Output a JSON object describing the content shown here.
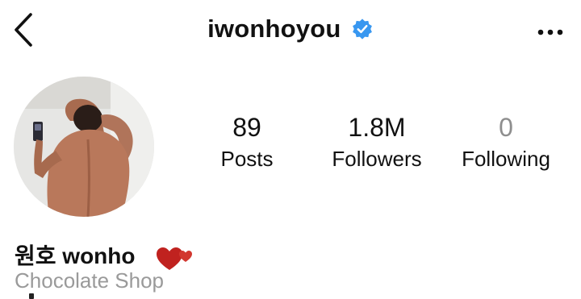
{
  "header": {
    "username": "iwonhoyou",
    "verified": true,
    "back_icon": "chevron-left-icon",
    "more_icon": "ellipsis-icon",
    "verified_color": "#3897f0"
  },
  "stats": [
    {
      "value": "89",
      "label": "Posts"
    },
    {
      "value": "1.8M",
      "label": "Followers"
    },
    {
      "value": "0",
      "label": "Following"
    }
  ],
  "profile": {
    "display_name": "원호 wonho",
    "category": "Chocolate Shop",
    "emoji": "two-hearts",
    "heart_color": "#c0221f"
  }
}
